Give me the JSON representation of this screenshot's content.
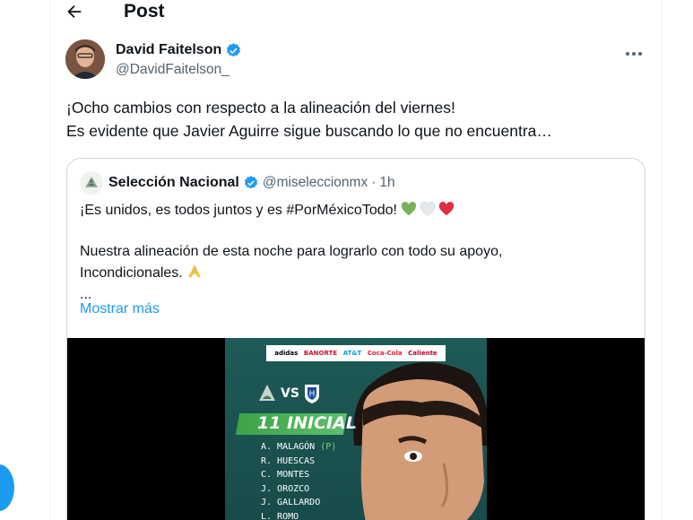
{
  "header": {
    "title": "Post"
  },
  "post": {
    "author_name": "David Faitelson",
    "author_handle": "@DavidFaitelson_",
    "text_lines": [
      "¡Ocho cambios con respecto a la alineación del viernes!",
      "Es evidente que Javier Aguirre sigue buscando lo que no encuentra…"
    ]
  },
  "quote": {
    "name": "Selección Nacional",
    "handle": "@miseleccionmx",
    "separator": "·",
    "time": "1h",
    "line1": "¡Es unidos, es todos juntos y es #PorMéxicoTodo!",
    "line2": "Nuestra alineación de esta noche para lograrlo con todo su apoyo,",
    "line3": "Incondicionales.",
    "ellipsis": "...",
    "show_more": "Mostrar más"
  },
  "graphic": {
    "sponsors": [
      "adidas",
      "BANORTE",
      "AT&T",
      "Coca-Cola",
      "Caliente"
    ],
    "vs": "VS",
    "title": "11 INICIAL",
    "lineup": [
      {
        "name": "A. MALAGÓN",
        "tag": "(P)"
      },
      {
        "name": "R. HUESCAS",
        "tag": ""
      },
      {
        "name": "C. MONTES",
        "tag": ""
      },
      {
        "name": "J. OROZCO",
        "tag": ""
      },
      {
        "name": "J. GALLARDO",
        "tag": ""
      },
      {
        "name": "L. ROMO",
        "tag": ""
      }
    ]
  },
  "colors": {
    "accent": "#1d9bf0",
    "graphic_green": "#1e5a57"
  }
}
